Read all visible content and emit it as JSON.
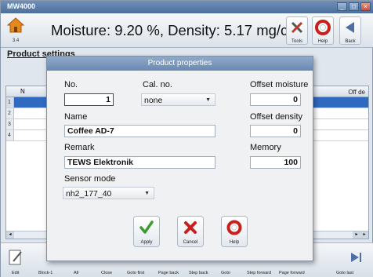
{
  "window": {
    "title": "MW4000",
    "controls": {
      "minimize": "_",
      "maximize": "□",
      "close": "×"
    }
  },
  "header": {
    "home_label": "3.4",
    "measurement": "Moisture: 9.20 %, Density: 5.17 mg/cm³",
    "tools_label": "Tools",
    "help_label": "Help",
    "back_label": "Back"
  },
  "background": {
    "section_title": "Product settings",
    "grid": {
      "col_no": "N",
      "col_offset": "Off de",
      "row_numbers": [
        "1",
        "2",
        "3",
        "4"
      ],
      "selected_row": 1
    },
    "toolbar": {
      "items": [
        "Edit",
        "Block-1",
        "All",
        "Close",
        "Goto first",
        "Page back",
        "Step back",
        "Goto",
        "Step forward",
        "Page forward",
        "Goto last"
      ]
    }
  },
  "dialog": {
    "title": "Product properties",
    "no_label": "No.",
    "no_value": "1",
    "cal_label": "Cal. no.",
    "cal_value": "none",
    "offset_moisture_label": "Offset moisture",
    "offset_moisture_value": "0",
    "name_label": "Name",
    "name_value": "Coffee AD-7",
    "offset_density_label": "Offset density",
    "offset_density_value": "0",
    "remark_label": "Remark",
    "remark_value": "TEWS Elektronik",
    "memory_label": "Memory",
    "memory_value": "100",
    "sensor_label": "Sensor mode",
    "sensor_value": "nh2_177_40",
    "apply_label": "Apply",
    "cancel_label": "Cancel",
    "help_label": "Help"
  },
  "colors": {
    "accent": "#2f6ac0",
    "dialog_title": "#6a89b2",
    "apply": "#3f9a2f",
    "cancel": "#c8201c"
  },
  "icons": [
    "home-icon",
    "tools-icon",
    "help-icon",
    "back-icon",
    "edit-icon",
    "goto-last-icon",
    "check-icon",
    "cross-icon",
    "lifebuoy-icon"
  ]
}
